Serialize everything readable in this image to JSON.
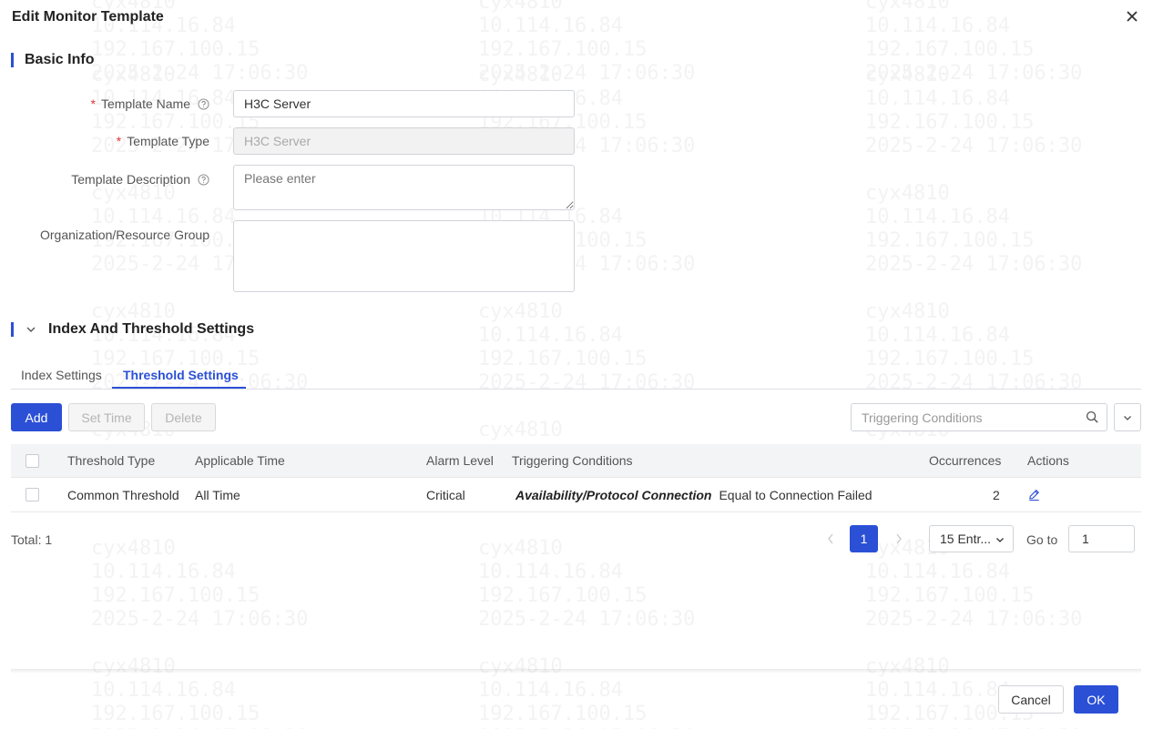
{
  "dialog": {
    "title": "Edit Monitor Template"
  },
  "basic_info": {
    "heading": "Basic Info",
    "template_name": {
      "label": "Template Name",
      "value": "H3C Server"
    },
    "template_type": {
      "label": "Template Type",
      "value": "H3C Server"
    },
    "template_description": {
      "label": "Template Description",
      "placeholder": "Please enter"
    },
    "org_group": {
      "label": "Organization/Resource Group"
    }
  },
  "index_section": {
    "heading": "Index And Threshold Settings",
    "tabs": [
      {
        "label": "Index Settings",
        "active": false
      },
      {
        "label": "Threshold Settings",
        "active": true
      }
    ]
  },
  "toolbar": {
    "add_label": "Add",
    "set_time_label": "Set Time",
    "delete_label": "Delete",
    "search_placeholder": "Triggering Conditions"
  },
  "table": {
    "columns": [
      "Threshold Type",
      "Applicable Time",
      "Alarm Level",
      "Triggering Conditions",
      "Occurrences",
      "Actions"
    ],
    "rows": [
      {
        "threshold_type": "Common Threshold",
        "applicable_time": "All Time",
        "alarm_level": "Critical",
        "condition_metric": "Availability/Protocol Connection",
        "condition_text": "Equal to Connection Failed",
        "occurrences": "2"
      }
    ]
  },
  "pagination": {
    "total": "Total: 1",
    "current_page": "1",
    "page_size": "15 Entr...",
    "goto_label": "Go to",
    "goto_value": "1"
  },
  "footer": {
    "cancel_label": "Cancel",
    "ok_label": "OK"
  },
  "colors": {
    "accent": "#2b50d6",
    "required": "#e0343a"
  },
  "watermark": {
    "text": "cyx4810\n10.114.16.84\n192.167.100.15\n2025-2-24 17:06:30"
  }
}
